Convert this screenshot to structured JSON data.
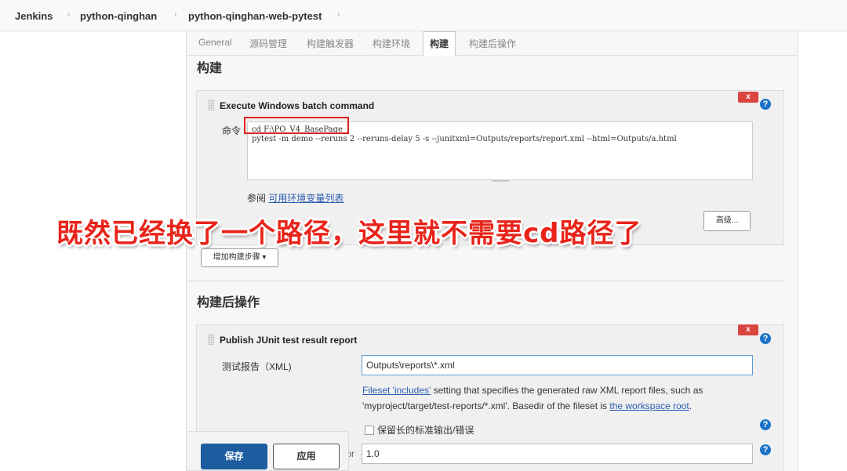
{
  "breadcrumb": {
    "items": [
      "Jenkins",
      "python-qinghan",
      "python-qinghan-web-pytest"
    ],
    "separator": "›"
  },
  "tabs": [
    "General",
    "源码管理",
    "构建触发器",
    "构建环境",
    "构建",
    "构建后操作"
  ],
  "active_tab": "构建",
  "build": {
    "section_title": "构建",
    "step_title": "Execute Windows batch command",
    "delete_label": "x",
    "help_glyph": "?",
    "command_label": "命令",
    "command_value": "cd F:\\PO_V4_BasePage\npytest -m demo --reruns 2 --reruns-delay 5 -s --junitxml=Outputs/reports/report.xml --html=Outputs/a.html",
    "see_prefix": "参阅 ",
    "env_link": "可用环境变量列表",
    "advanced_button": "高级...",
    "add_step_button": "增加构建步骤 ▾"
  },
  "annotation": "既然已经换了一个路径，这里就不需要cd路径了",
  "post_build": {
    "section_title": "构建后操作",
    "step_title": "Publish JUnit test result report",
    "delete_label": "x",
    "report_label": "测试报告（XML)",
    "report_value": "Outputs\\reports\\*.xml",
    "desc_link1": "Fileset 'includes'",
    "desc_text1": " setting that specifies the generated raw XML report files, such as 'myproject/target/test-reports/*.xml'. Basedir of the fileset is ",
    "desc_link2": "the workspace root",
    "desc_text2": ".",
    "checkbox_label": "保留长的标准输出/错误",
    "factor_label_partial": "ctor",
    "factor_value": "1.0"
  },
  "footer": {
    "save_label": "保存",
    "apply_label": "应用"
  },
  "colors": {
    "primary_button": "#1d5c9e",
    "delete_button": "#d9443f",
    "annotation_text": "#e8241a",
    "link": "#2a5db0",
    "help_icon": "#1a73c7"
  }
}
